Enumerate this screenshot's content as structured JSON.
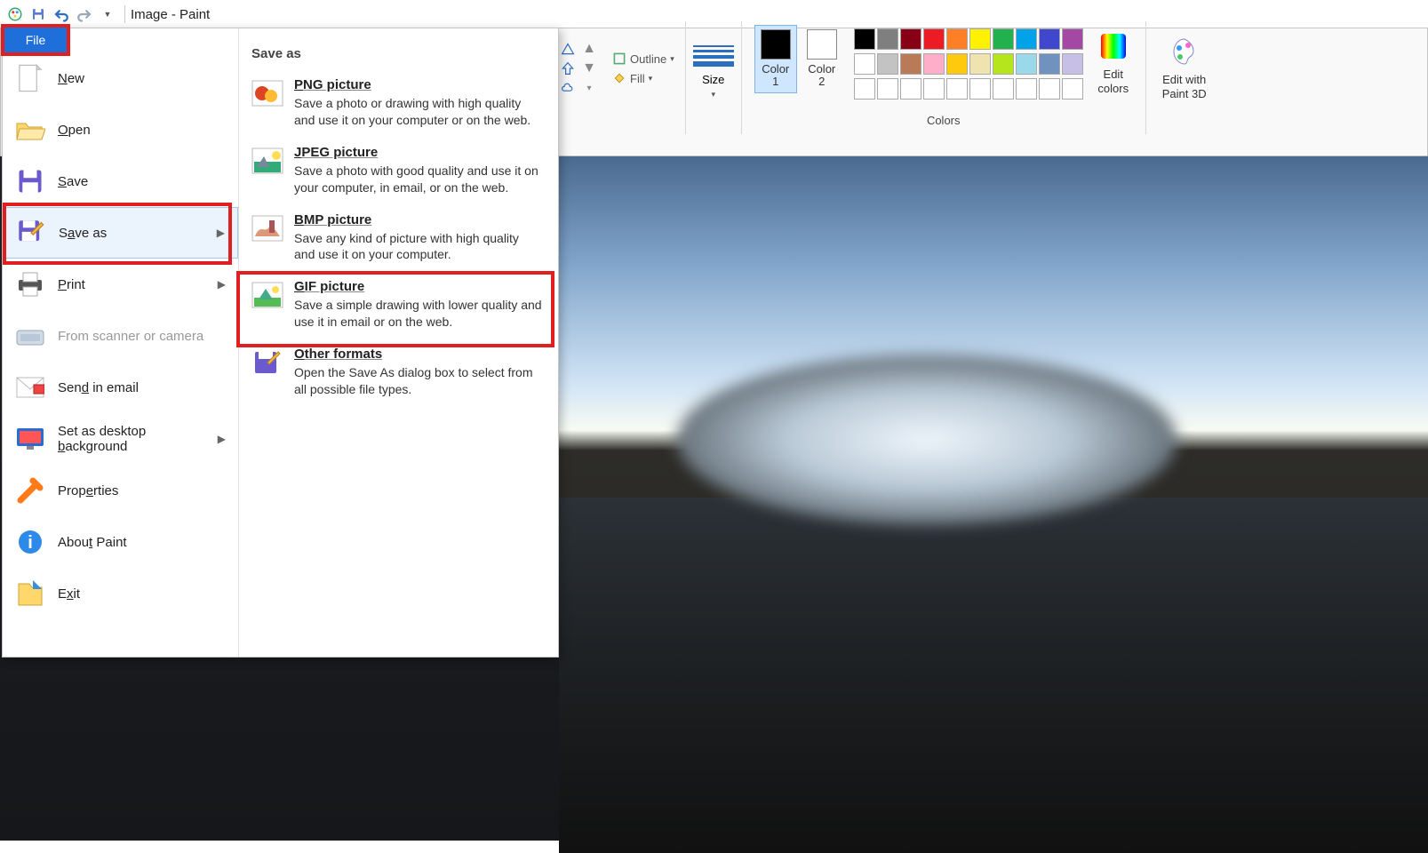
{
  "title": "Image - Paint",
  "ribbon": {
    "outline_label": "Outline",
    "fill_label": "Fill",
    "size_label": "Size",
    "color1_label": "Color\n1",
    "color2_label": "Color\n2",
    "edit_colors_label": "Edit\ncolors",
    "edit_paint3d_label": "Edit with\nPaint 3D",
    "colors_group_label": "Colors",
    "palette_row1": [
      "#000000",
      "#7f7f7f",
      "#880015",
      "#ed1c24",
      "#ff7f27",
      "#fff200",
      "#22b14c",
      "#00a2e8",
      "#3f48cc",
      "#a349a4"
    ],
    "palette_row2": [
      "#ffffff",
      "#c3c3c3",
      "#b97a57",
      "#ffaec9",
      "#ffc90e",
      "#efe4b0",
      "#b5e61d",
      "#99d9ea",
      "#7092be",
      "#c8bfe7"
    ],
    "palette_row3": [
      "#ffffff",
      "#ffffff",
      "#ffffff",
      "#ffffff",
      "#ffffff",
      "#ffffff",
      "#ffffff",
      "#ffffff",
      "#ffffff",
      "#ffffff"
    ],
    "color1_value": "#000000",
    "color2_value": "#ffffff"
  },
  "file_menu": {
    "button": "File",
    "items": [
      {
        "label": "New",
        "icon": "new",
        "hotkey": "N"
      },
      {
        "label": "Open",
        "icon": "open",
        "hotkey": "O"
      },
      {
        "label": "Save",
        "icon": "save",
        "hotkey": "S"
      },
      {
        "label": "Save as",
        "icon": "saveas",
        "hotkey": "a",
        "submenu": true,
        "hover": true
      },
      {
        "label": "Print",
        "icon": "print",
        "hotkey": "P",
        "submenu": true
      },
      {
        "label": "From scanner or camera",
        "icon": "scanner",
        "disabled": true
      },
      {
        "label": "Send in email",
        "icon": "email",
        "hotkey": "d"
      },
      {
        "label": "Set as desktop background",
        "icon": "desktop",
        "hotkey": "b",
        "submenu": true
      },
      {
        "label": "Properties",
        "icon": "properties",
        "hotkey": "e"
      },
      {
        "label": "About Paint",
        "icon": "about",
        "hotkey": "t"
      },
      {
        "label": "Exit",
        "icon": "exit",
        "hotkey": "x"
      }
    ],
    "saveas_panel": {
      "title": "Save as",
      "options": [
        {
          "title": "PNG picture",
          "hot": "P",
          "desc": "Save a photo or drawing with high quality and use it on your computer or on the web."
        },
        {
          "title": "JPEG picture",
          "hot": "J",
          "desc": "Save a photo with good quality and use it on your computer, in email, or on the web."
        },
        {
          "title": "BMP picture",
          "hot": "B",
          "desc": "Save any kind of picture with high quality and use it on your computer."
        },
        {
          "title": "GIF picture",
          "hot": "G",
          "desc": "Save a simple drawing with lower quality and use it in email or on the web."
        },
        {
          "title": "Other formats",
          "hot": "O",
          "desc": "Open the Save As dialog box to select from all possible file types."
        }
      ]
    }
  },
  "highlights": [
    "file-button",
    "save-as",
    "gif-picture"
  ]
}
